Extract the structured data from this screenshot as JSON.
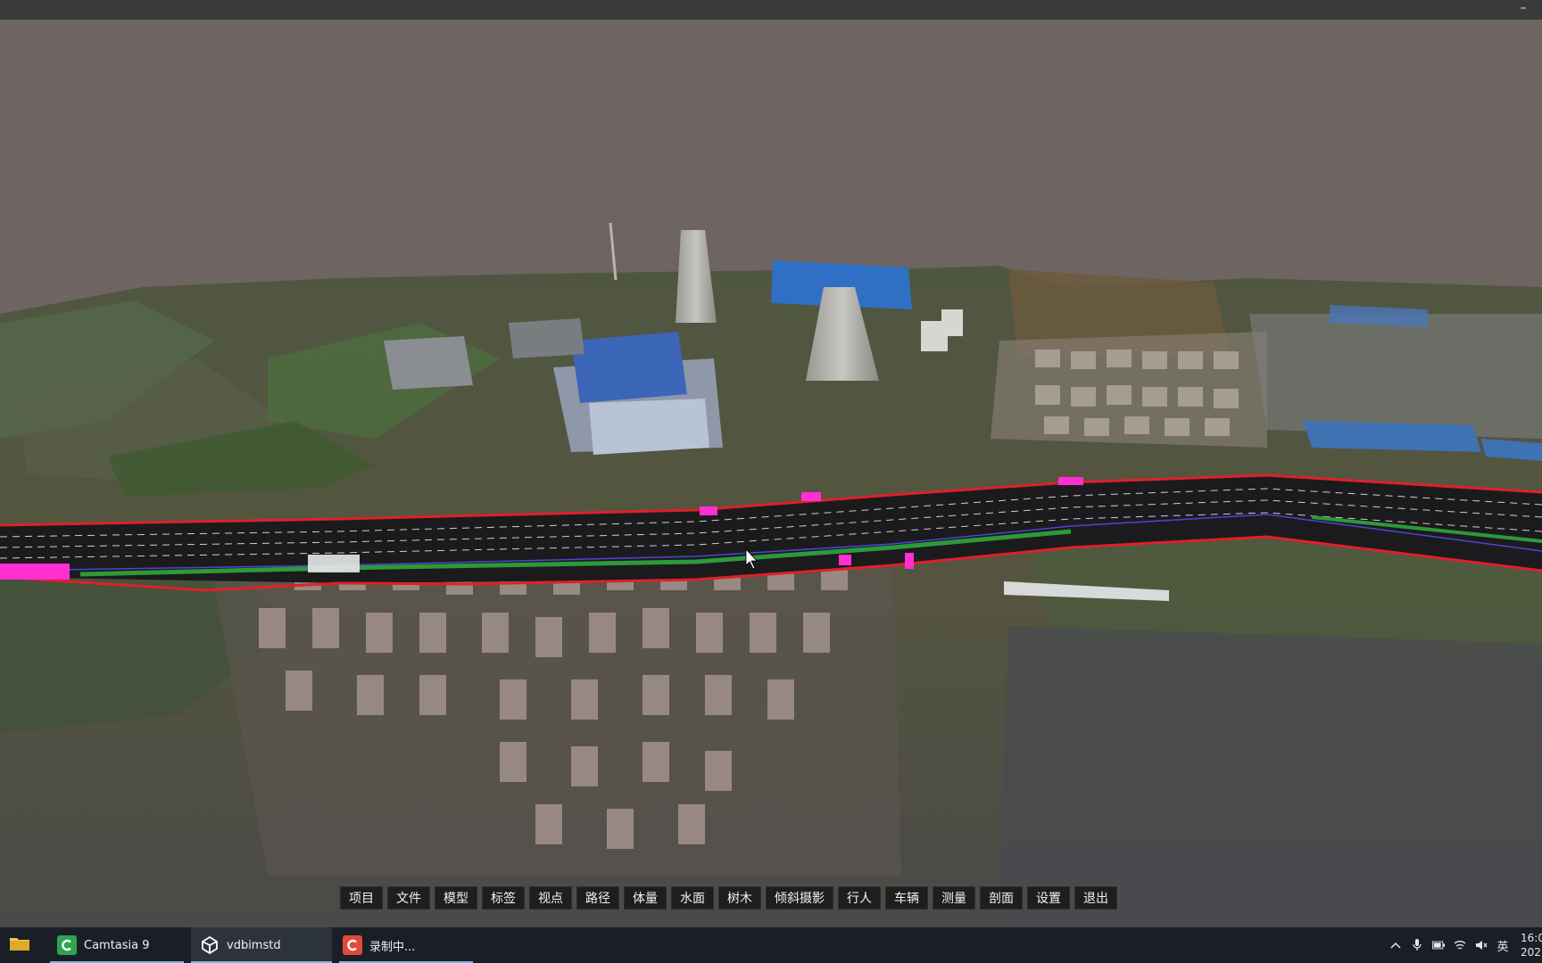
{
  "window": {
    "minimize_glyph": "–"
  },
  "toolbar": {
    "items": [
      "项目",
      "文件",
      "模型",
      "标签",
      "视点",
      "路径",
      "体量",
      "水面",
      "树木",
      "倾斜摄影",
      "行人",
      "车辆",
      "测量",
      "剖面",
      "设置",
      "退出"
    ]
  },
  "taskbar": {
    "apps": [
      {
        "label": "Camtasia 9",
        "icon": "camtasia-icon",
        "color": "#2ea44f"
      },
      {
        "label": "vdbimstd",
        "icon": "unity-icon",
        "color": "#ffffff"
      },
      {
        "label": "录制中...",
        "icon": "recorder-icon",
        "color": "#e04a3a"
      }
    ],
    "tray": {
      "ime": "英",
      "time": "16:0",
      "date": "202"
    }
  },
  "colors": {
    "sky": "#6e6462",
    "road_edge": "#e0202a",
    "road_marker": "#ff2fd2",
    "toolbar_bg": "#1e1e1e",
    "taskbar_bg": "#1a1f27"
  }
}
